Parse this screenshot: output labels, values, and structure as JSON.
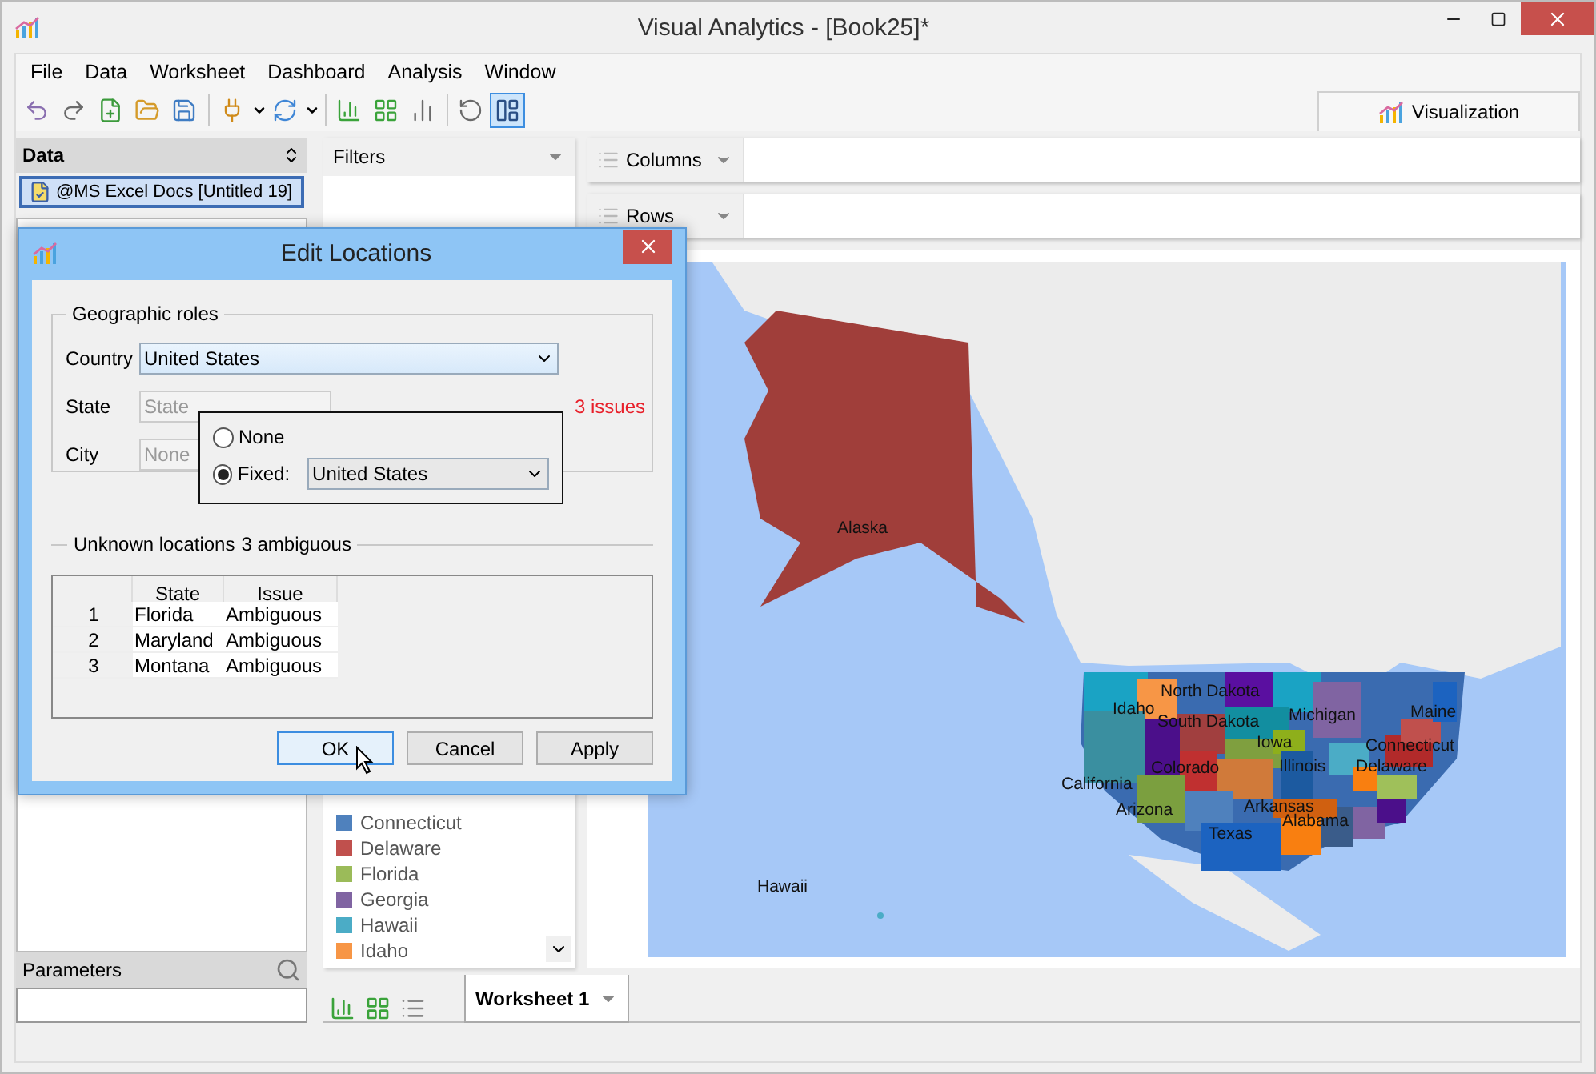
{
  "window": {
    "title": "Visual Analytics - [Book25]*"
  },
  "menu": [
    "File",
    "Data",
    "Worksheet",
    "Dashboard",
    "Analysis",
    "Window"
  ],
  "toolbar": [
    {
      "kind": "undo",
      "pressed": false
    },
    {
      "kind": "redo",
      "pressed": false
    },
    {
      "kind": "new",
      "pressed": false
    },
    {
      "kind": "open",
      "pressed": false
    },
    {
      "kind": "save",
      "pressed": false
    },
    {
      "kind": "connect",
      "pressed": false
    },
    {
      "kind": "refresh",
      "pressed": false
    },
    {
      "kind": "new-sheet",
      "pressed": false
    },
    {
      "kind": "new-dashboard",
      "pressed": false
    },
    {
      "kind": "chart",
      "pressed": false
    },
    {
      "kind": "clear",
      "pressed": false
    },
    {
      "kind": "layout",
      "pressed": true
    }
  ],
  "view_tab": {
    "label": "Visualization"
  },
  "data_panel": {
    "title": "Data",
    "source": {
      "label": "@MS Excel Docs [Untitled 19]",
      "selected": true
    }
  },
  "parameters_panel": {
    "title": "Parameters"
  },
  "filters": {
    "title": "Filters"
  },
  "legend": [
    {
      "label": "Connecticut",
      "color": "#4f81bd"
    },
    {
      "label": "Delaware",
      "color": "#c0504d"
    },
    {
      "label": "Florida",
      "color": "#9bbb59"
    },
    {
      "label": "Georgia",
      "color": "#8064a2"
    },
    {
      "label": "Hawaii",
      "color": "#4bacc6"
    },
    {
      "label": "Idaho",
      "color": "#f79646"
    }
  ],
  "shelves": [
    {
      "label": "Columns"
    },
    {
      "label": "Rows"
    }
  ],
  "map": {
    "labels": [
      "Alaska",
      "Hawaii",
      "North Dakota",
      "Idaho",
      "South Dakota",
      "Michigan",
      "Maine",
      "Iowa",
      "Colorado",
      "Illinois",
      "Connecticut",
      "Delaware",
      "California",
      "Arizona",
      "Arkansas",
      "Alabama",
      "Texas"
    ]
  },
  "sheet_tabs": [
    {
      "label": "Worksheet 1",
      "selected": true
    }
  ],
  "dialog": {
    "title": "Edit Locations",
    "group_title": "Geographic roles",
    "fields": [
      {
        "label": "Country",
        "value": "United States",
        "disabled": false
      },
      {
        "label": "State",
        "value": "State",
        "disabled": true
      },
      {
        "label": "City",
        "value": "None",
        "disabled": true
      }
    ],
    "issues": "3 issues",
    "popup": {
      "options": [
        {
          "label": "None",
          "selected": false
        },
        {
          "label": "Fixed:",
          "selected": true,
          "value": "United States"
        }
      ]
    },
    "unknown": {
      "title": "Unknown locations",
      "summary": "3 ambiguous"
    },
    "table": {
      "columns": [
        "State",
        "Issue"
      ],
      "rows": [
        {
          "index": "1",
          "state": "Florida",
          "issue": "Ambiguous"
        },
        {
          "index": "2",
          "state": "Maryland",
          "issue": "Ambiguous"
        },
        {
          "index": "3",
          "state": "Montana",
          "issue": "Ambiguous"
        }
      ]
    },
    "buttons": [
      {
        "label": "OK",
        "default": true
      },
      {
        "label": "Cancel",
        "default": false
      },
      {
        "label": "Apply",
        "default": false
      }
    ]
  }
}
